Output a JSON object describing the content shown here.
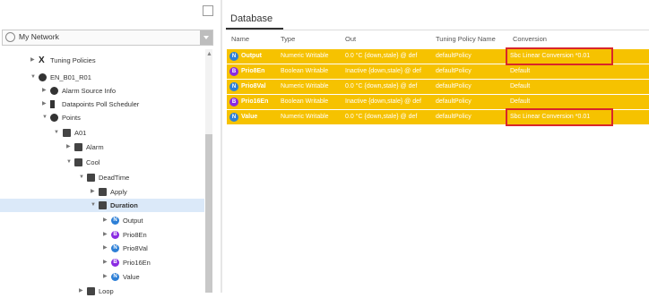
{
  "network": {
    "label": "My Network"
  },
  "tree": [
    {
      "label": "Tuning Policies"
    },
    {
      "label": "EN_B01_R01"
    },
    {
      "label": "Alarm Source Info"
    },
    {
      "label": "Datapoints Poll Scheduler"
    },
    {
      "label": "Points"
    },
    {
      "label": "A01"
    },
    {
      "label": "Alarm"
    },
    {
      "label": "Cool"
    },
    {
      "label": "DeadTime"
    },
    {
      "label": "Apply"
    },
    {
      "label": "Duration"
    },
    {
      "label": "Output"
    },
    {
      "label": "Prio8En"
    },
    {
      "label": "Prio8Val"
    },
    {
      "label": "Prio16En"
    },
    {
      "label": "Value"
    },
    {
      "label": "Loop"
    }
  ],
  "database": {
    "tab_label": "Database",
    "columns": [
      "Name",
      "Type",
      "Out",
      "Tuning Policy Name",
      "Conversion"
    ],
    "rows": [
      {
        "name": "Output",
        "icon": "N",
        "type": "Numeric Writable",
        "out": "0.0 °C {down,stale} @ def",
        "policy": "defaultPolicy",
        "conversion": "Sbc Linear Conversion *0.01"
      },
      {
        "name": "Prio8En",
        "icon": "B",
        "type": "Boolean Writable",
        "out": "Inactive {down,stale} @ def",
        "policy": "defaultPolicy",
        "conversion": "Default"
      },
      {
        "name": "Prio8Val",
        "icon": "N",
        "type": "Numeric Writable",
        "out": "0.0 °C {down,stale} @ def",
        "policy": "defaultPolicy",
        "conversion": "Default"
      },
      {
        "name": "Prio16En",
        "icon": "B",
        "type": "Boolean Writable",
        "out": "Inactive {down,stale} @ def",
        "policy": "defaultPolicy",
        "conversion": "Default"
      },
      {
        "name": "Value",
        "icon": "N",
        "type": "Numeric Writable",
        "out": "0.0 °C {down,stale} @ def",
        "policy": "defaultPolicy",
        "conversion": "Sbc Linear Conversion *0.01"
      }
    ]
  },
  "colors": {
    "row_bg": "#f6c200",
    "highlight": "#d8262a",
    "numeric_icon": "#2d7fd6",
    "boolean_icon": "#8a2be2"
  }
}
